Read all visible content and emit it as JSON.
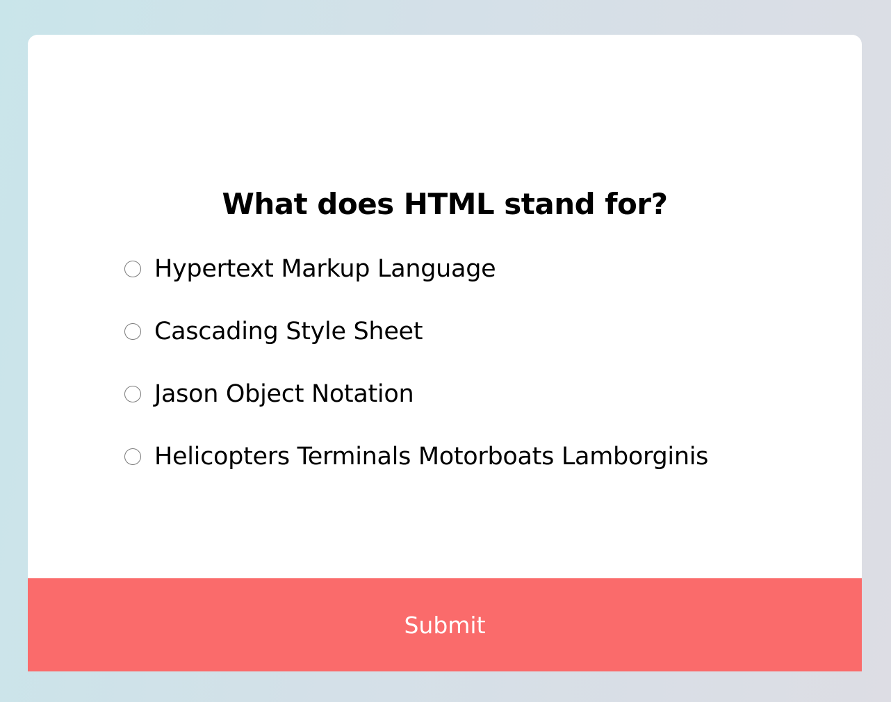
{
  "quiz": {
    "question": "What does HTML stand for?",
    "answers": [
      {
        "label": "Hypertext Markup Language",
        "selected": false
      },
      {
        "label": "Cascading Style Sheet",
        "selected": false
      },
      {
        "label": "Jason Object Notation",
        "selected": false
      },
      {
        "label": "Helicopters Terminals Motorboats Lamborginis",
        "selected": false
      }
    ],
    "submit_label": "Submit"
  },
  "colors": {
    "submit_background": "#fa6b6b",
    "card_background": "#ffffff",
    "text": "#000000"
  }
}
